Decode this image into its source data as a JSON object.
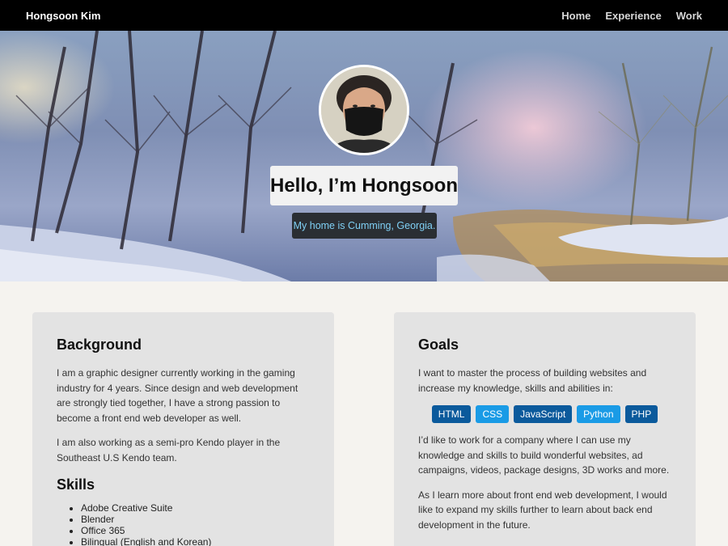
{
  "nav": {
    "brand": "Hongsoon Kim",
    "links": [
      "Home",
      "Experience",
      "Work"
    ]
  },
  "hero": {
    "title": "Hello, I’m Hongsoon",
    "subtitle": "My home is Cumming, Georgia."
  },
  "background": {
    "heading": "Background",
    "paragraphs": [
      "I am a graphic designer currently working in the gaming industry for 4 years. Since design and web development are strongly tied together, I have a strong passion to become a front end web developer as well.",
      "I am also working as a semi-pro Kendo player in the Southeast U.S Kendo team."
    ]
  },
  "skills": {
    "heading": "Skills",
    "items": [
      "Adobe Creative Suite",
      "Blender",
      "Office 365",
      "Bilingual (English and Korean)"
    ]
  },
  "goals": {
    "heading": "Goals",
    "intro": "I want to master the process of building websites and increase my knowledge, skills and abilities in:",
    "tags": [
      {
        "label": "HTML",
        "color": "#0b5a9c"
      },
      {
        "label": "CSS",
        "color": "#1a9be6"
      },
      {
        "label": "JavaScript",
        "color": "#0b5a9c"
      },
      {
        "label": "Python",
        "color": "#1a9be6"
      },
      {
        "label": "PHP",
        "color": "#0b5a9c"
      }
    ],
    "paragraphs": [
      "I’d like to work for a company where I can use my knowledge and skills to build wonderful websites, ad campaigns, videos, package designs, 3D works and more.",
      "As I learn more about front end web development, I would like to expand my skills further to learn about back end development in the future."
    ]
  }
}
